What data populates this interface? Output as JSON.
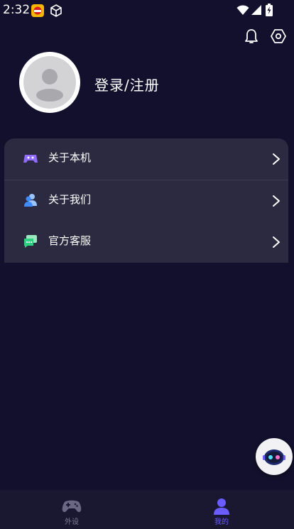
{
  "status_bar": {
    "time": "2:32",
    "app_icons": [
      "flame-app-icon",
      "cube-app-icon"
    ],
    "indicators": [
      "wifi-icon",
      "signal-icon",
      "battery-charging-icon"
    ]
  },
  "header": {
    "icons": [
      "bell-icon",
      "gear-icon"
    ]
  },
  "profile": {
    "login_label": "登录/注册"
  },
  "menu": {
    "items": [
      {
        "label": "关于本机",
        "icon": "controller-icon",
        "icon_color": "#8f6bff"
      },
      {
        "label": "关于我们",
        "icon": "people-icon",
        "icon_color": "#3f8cff"
      },
      {
        "label": "官方客服",
        "icon": "chat-icon",
        "icon_color": "#2fcf7e"
      }
    ]
  },
  "fab": {
    "icon": "robot-assistant-icon"
  },
  "tabbar": {
    "tabs": [
      {
        "label": "外设",
        "icon": "gamepad-icon",
        "active": false
      },
      {
        "label": "我的",
        "icon": "user-icon",
        "active": true
      }
    ]
  },
  "colors": {
    "background": "#12102c",
    "card": "#2b2a40",
    "active_tab": "#6b5cff",
    "inactive_tab": "#7c7a94"
  }
}
